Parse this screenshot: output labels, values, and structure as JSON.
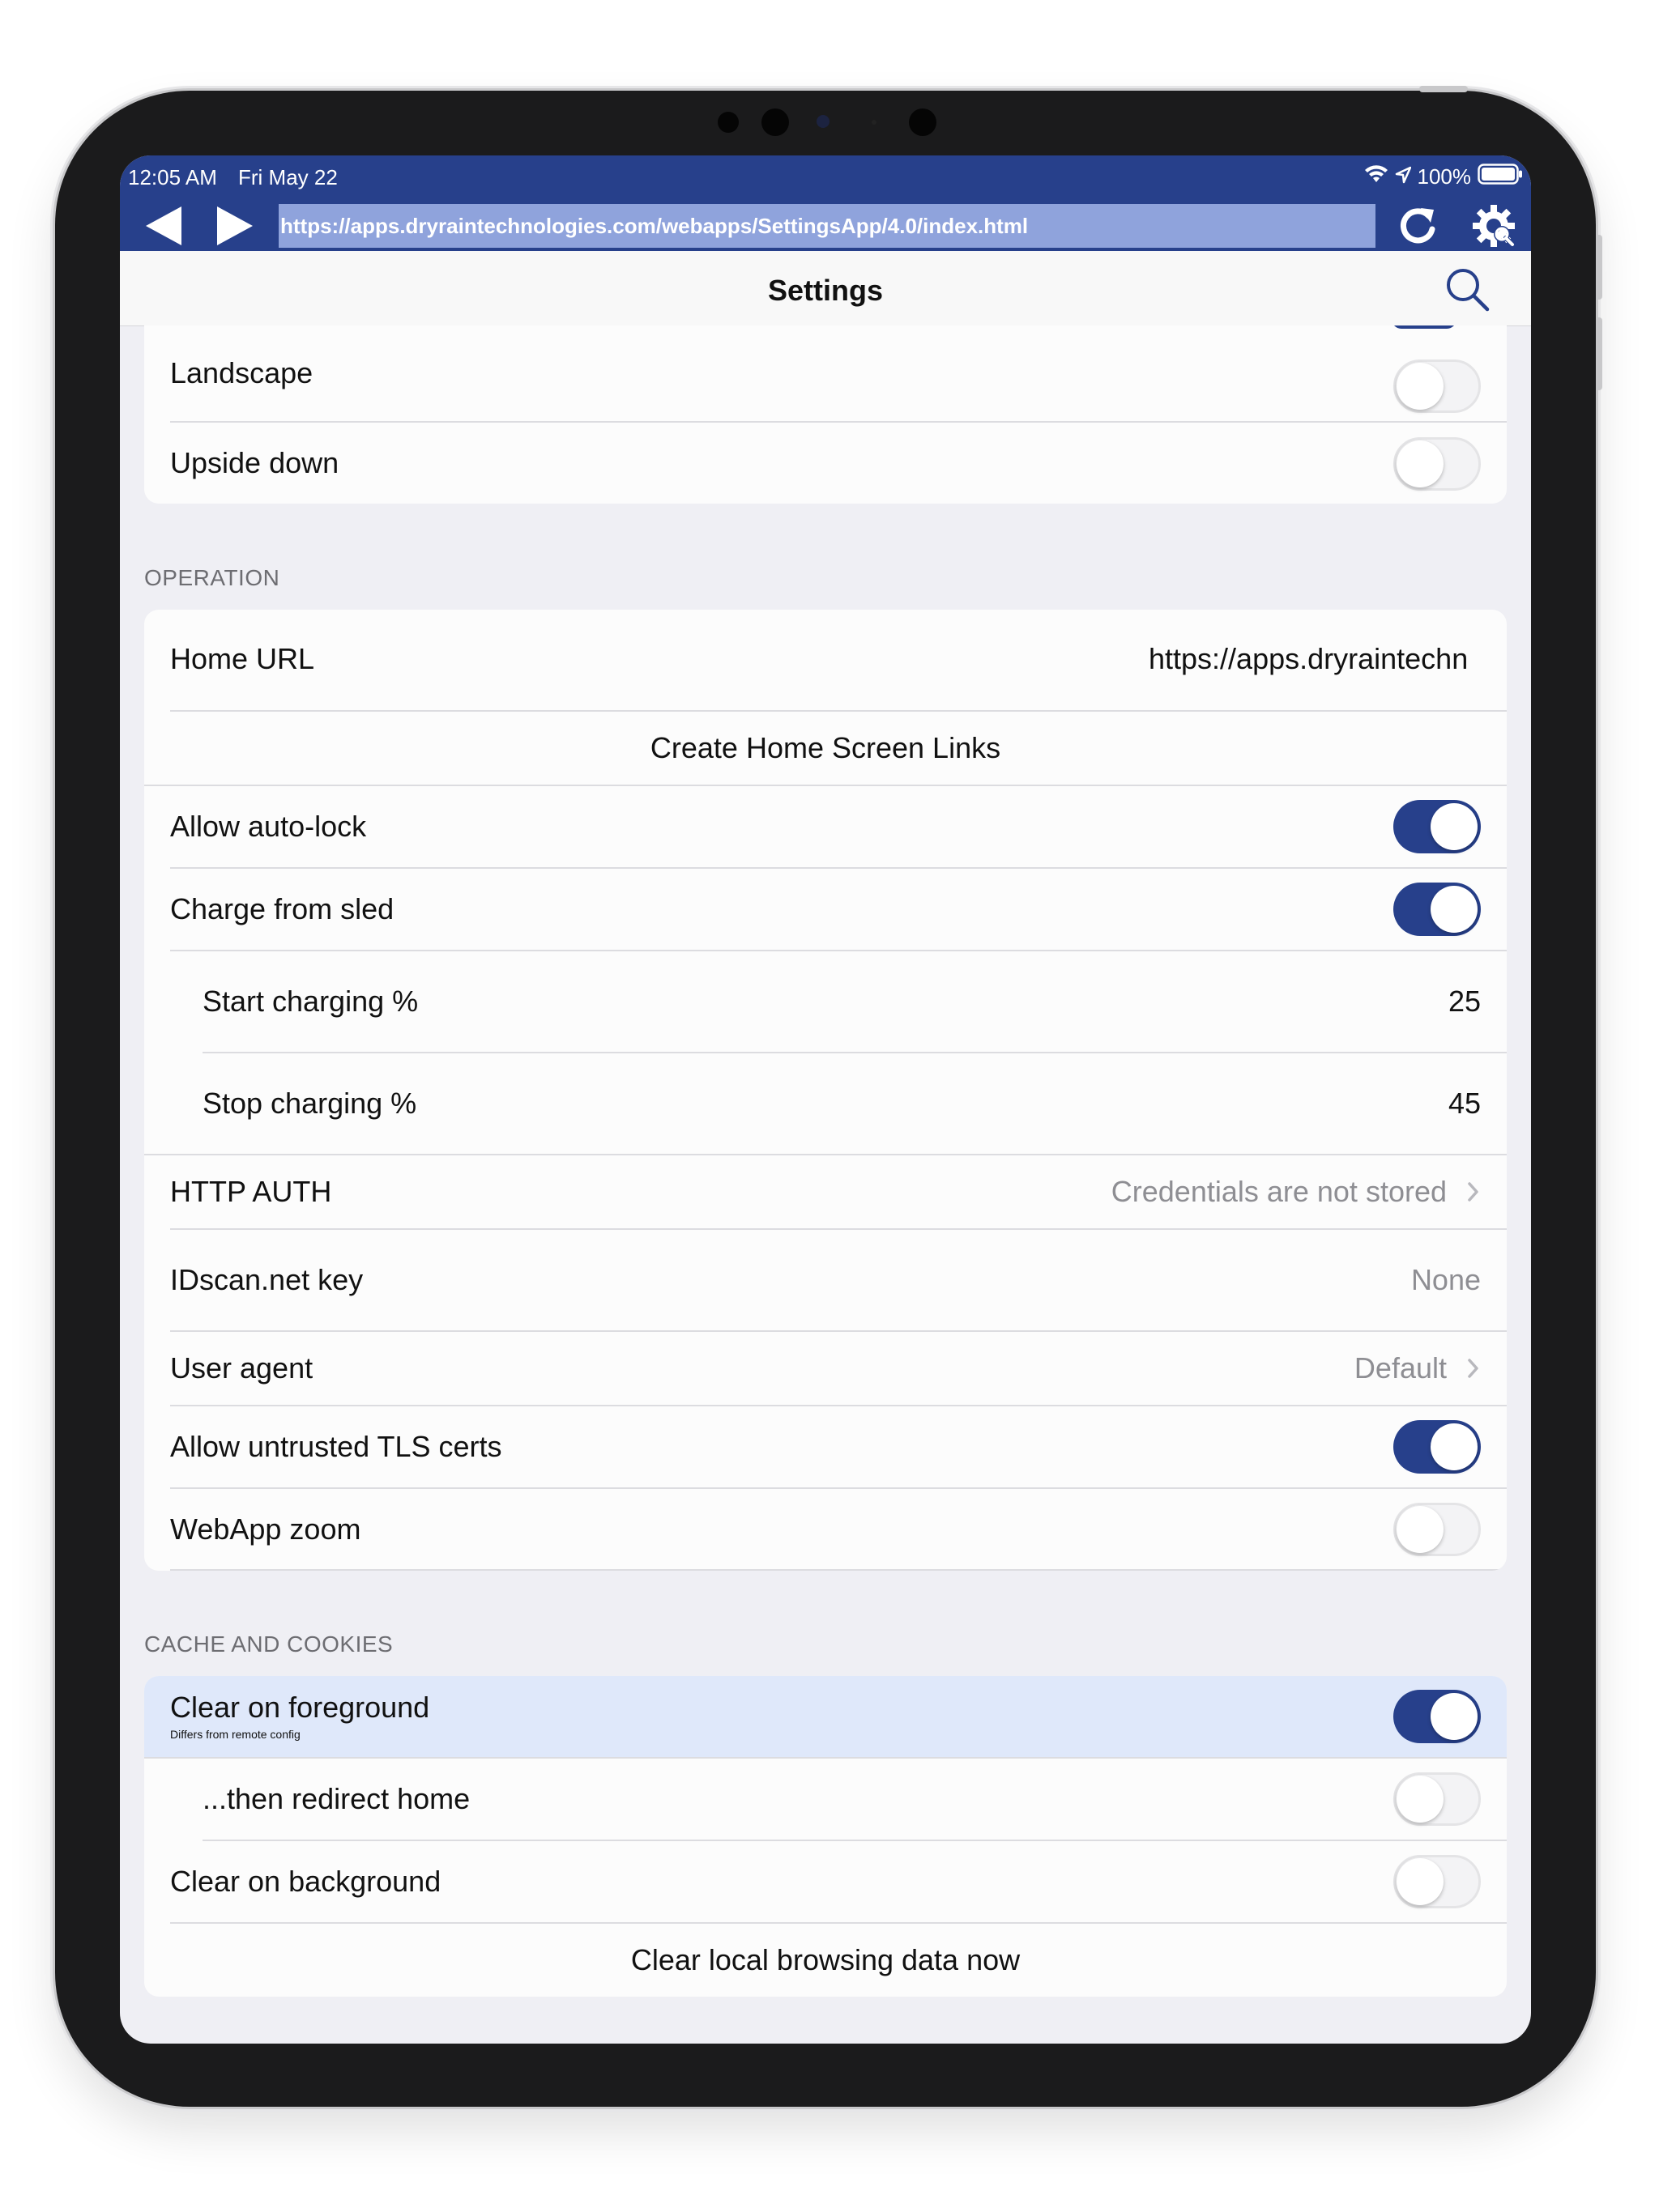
{
  "status_bar": {
    "time": "12:05 AM",
    "date": "Fri May 22",
    "battery": "100%"
  },
  "toolbar": {
    "back_icon": "back-arrow-icon",
    "forward_icon": "forward-arrow-icon",
    "url": "https://apps.dryraintechnologies.com/webapps/SettingsApp/4.0/index.html",
    "reload_icon": "reload-icon",
    "settings_icon": "gear-icon"
  },
  "navbar": {
    "title": "Settings",
    "search_icon": "search-icon"
  },
  "orientation_group": {
    "rows": [
      {
        "label": "Landscape",
        "toggle": false
      },
      {
        "label": "Upside down",
        "toggle": false
      }
    ]
  },
  "operation": {
    "header": "OPERATION",
    "home_url_label": "Home URL",
    "home_url_value": "https://apps.dryraintechn",
    "create_links": "Create Home Screen Links",
    "allow_autolock": {
      "label": "Allow auto-lock",
      "toggle": true
    },
    "charge_from_sled": {
      "label": "Charge from sled",
      "toggle": true
    },
    "start_charging": {
      "label": "Start charging %",
      "value": "25"
    },
    "stop_charging": {
      "label": "Stop charging %",
      "value": "45"
    },
    "http_auth": {
      "label": "HTTP AUTH",
      "value": "Credentials are not stored"
    },
    "idscan_key": {
      "label": "IDscan.net key",
      "value": "None"
    },
    "user_agent": {
      "label": "User agent",
      "value": "Default"
    },
    "untrusted_tls": {
      "label": "Allow untrusted TLS certs",
      "toggle": true
    },
    "webapp_zoom": {
      "label": "WebApp zoom",
      "toggle": false
    }
  },
  "cache": {
    "header": "CACHE AND COOKIES",
    "clear_foreground": {
      "label": "Clear on foreground",
      "sublabel": "Differs from remote config",
      "toggle": true
    },
    "redirect_home": {
      "label": "...then redirect home",
      "toggle": false
    },
    "clear_background": {
      "label": "Clear on background",
      "toggle": false
    },
    "clear_now": "Clear local browsing data now"
  },
  "colors": {
    "accent": "#27408b",
    "highlight_row": "#dfe8fa",
    "url_field": "#8fa3dc"
  }
}
